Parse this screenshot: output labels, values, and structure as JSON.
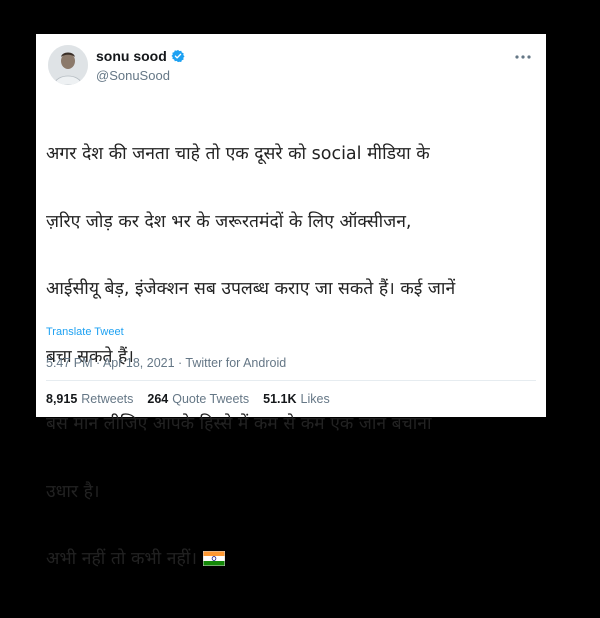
{
  "tweet": {
    "display_name": "sonu sood",
    "handle": "@SonuSood",
    "text_lines": [
      "अगर देश की जनता चाहे तो एक दूसरे को social मीडिया के",
      "ज़रिए जोड़ कर देश भर के जरूरतमंदों के लिए ऑक्सीजन,",
      "आईसीयू बेड़, इंजेक्शन सब उपलब्ध कराए जा सकते हैं। कई जानें",
      "बचा सकते हैं।",
      "बस मान लीजिए आपके हिस्से में कम से कम एक जान बचाना",
      "उधार है।",
      "अभी नहीं तो कभी नहीं।"
    ],
    "flag_emoji": "india-flag",
    "translate_label": "Translate Tweet",
    "meta": "5:47 PM · Apr 18, 2021 · Twitter for Android",
    "stats": {
      "retweets_count": "8,915",
      "retweets_label": "Retweets",
      "quote_count": "264",
      "quote_label": "Quote Tweets",
      "likes_count": "51.1K",
      "likes_label": "Likes"
    }
  },
  "colors": {
    "background": "#000000",
    "card": "#ffffff",
    "link": "#1da1f2",
    "secondary_text": "#657786"
  }
}
